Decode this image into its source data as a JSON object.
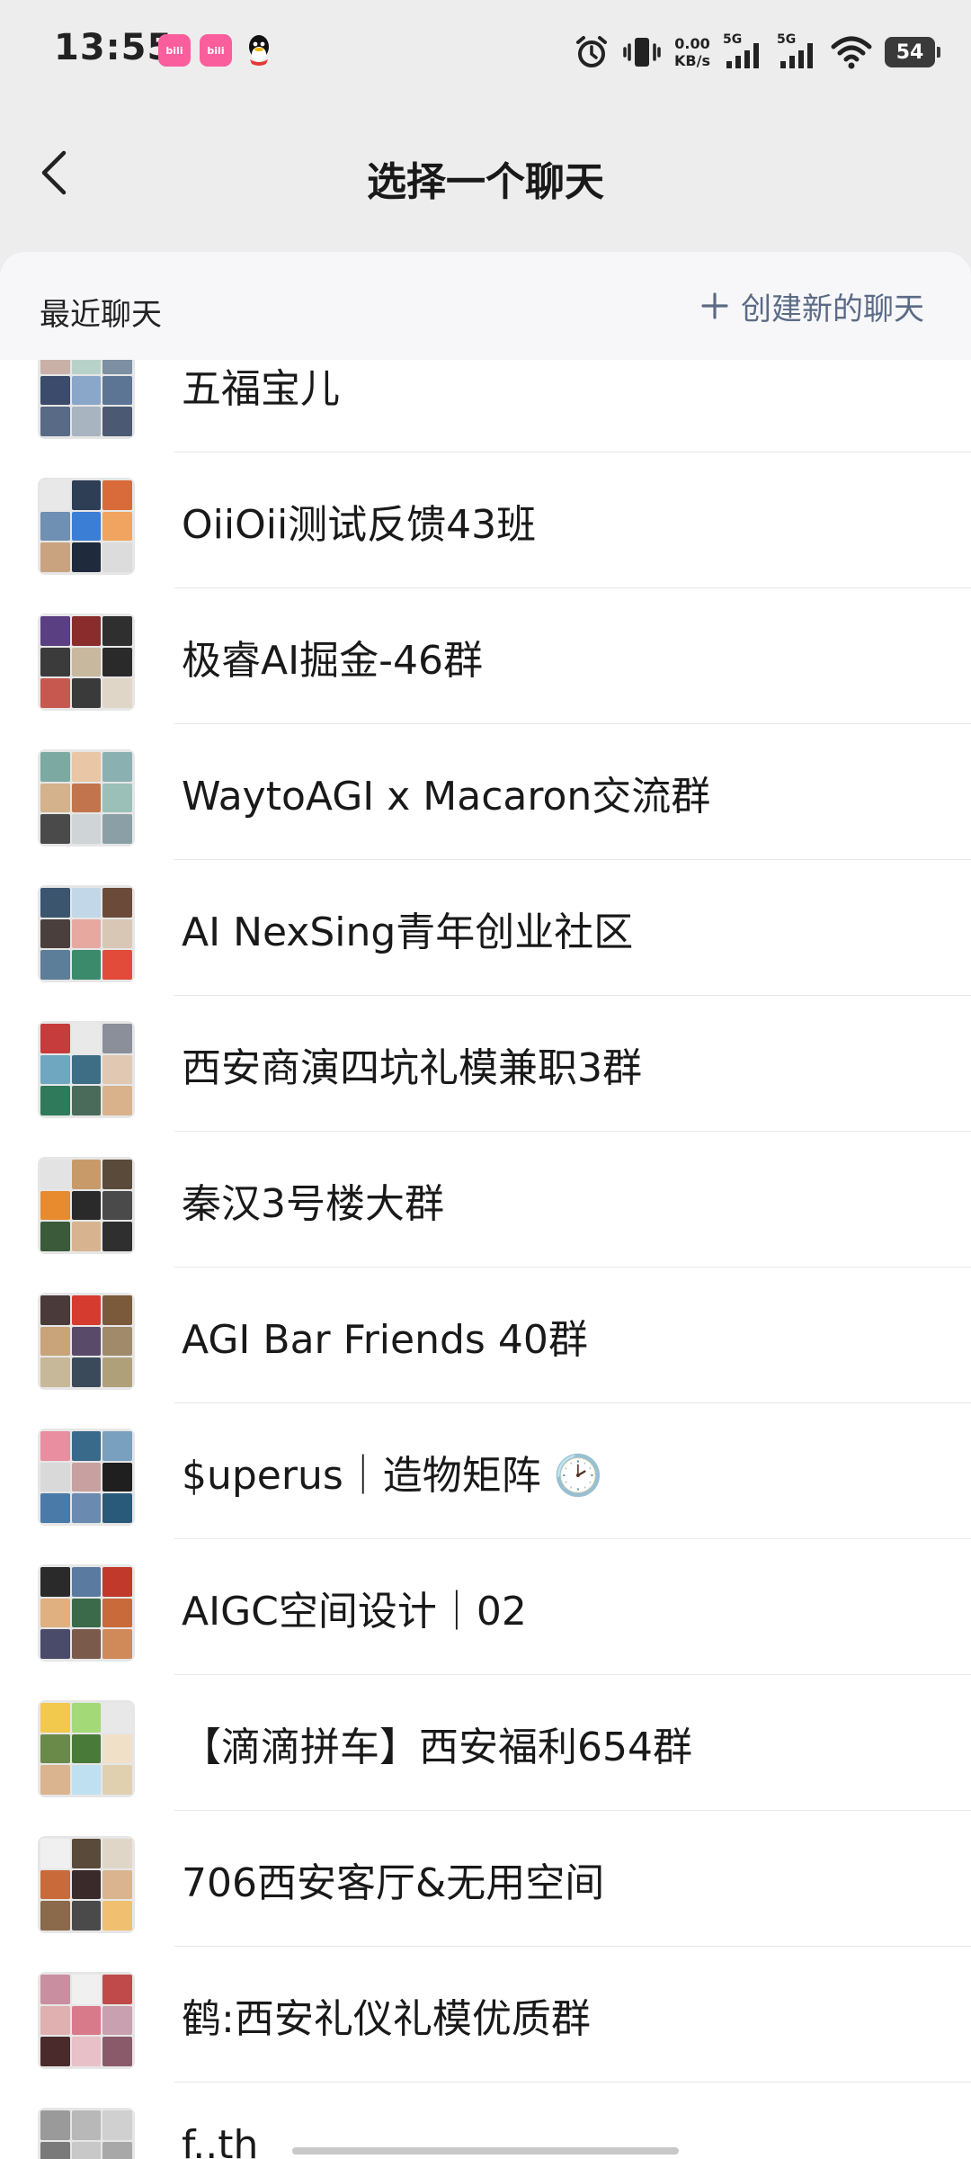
{
  "status_bar": {
    "time": "13:55",
    "network_speed_value": "0.00",
    "network_speed_unit": "KB/s",
    "sim1_label": "5G",
    "sim2_label": "5G",
    "battery": "54",
    "app_badge_text": "bili",
    "icons": [
      "bilibili-icon",
      "bilibili-icon",
      "qq-icon",
      "alarm-icon",
      "vibrate-icon",
      "signal-icon",
      "signal-icon",
      "wifi-icon",
      "battery-icon"
    ]
  },
  "nav": {
    "title": "选择一个聊天",
    "back_icon": "chevron-left-icon"
  },
  "sheet": {
    "section_label": "最近聊天",
    "create_label": "创建新的聊天",
    "create_icon": "plus-icon"
  },
  "chats": [
    {
      "name": "五福宝儿"
    },
    {
      "name": "OiiOii测试反馈43班"
    },
    {
      "name": "极睿AI掘金-46群"
    },
    {
      "name": "WaytoAGI x Macaron交流群"
    },
    {
      "name": "AI NexSing青年创业社区"
    },
    {
      "name": "西安商演四坑礼模兼职3群"
    },
    {
      "name": "秦汉3号楼大群"
    },
    {
      "name": "AGI Bar Friends 40群"
    },
    {
      "name": "$uperus｜造物矩阵 🕑"
    },
    {
      "name": "AIGC空间设计｜02"
    },
    {
      "name": "【滴滴拼车】西安福利654群"
    },
    {
      "name": "706西安客厅&无用空间"
    },
    {
      "name": "鹤:西安礼仪礼模优质群"
    },
    {
      "name": "f..th"
    }
  ],
  "colors": {
    "background": "#ededed",
    "sheet": "#f7f7f9",
    "list": "#ffffff",
    "link": "#5b6b86",
    "divider": "#e8e8e8"
  }
}
